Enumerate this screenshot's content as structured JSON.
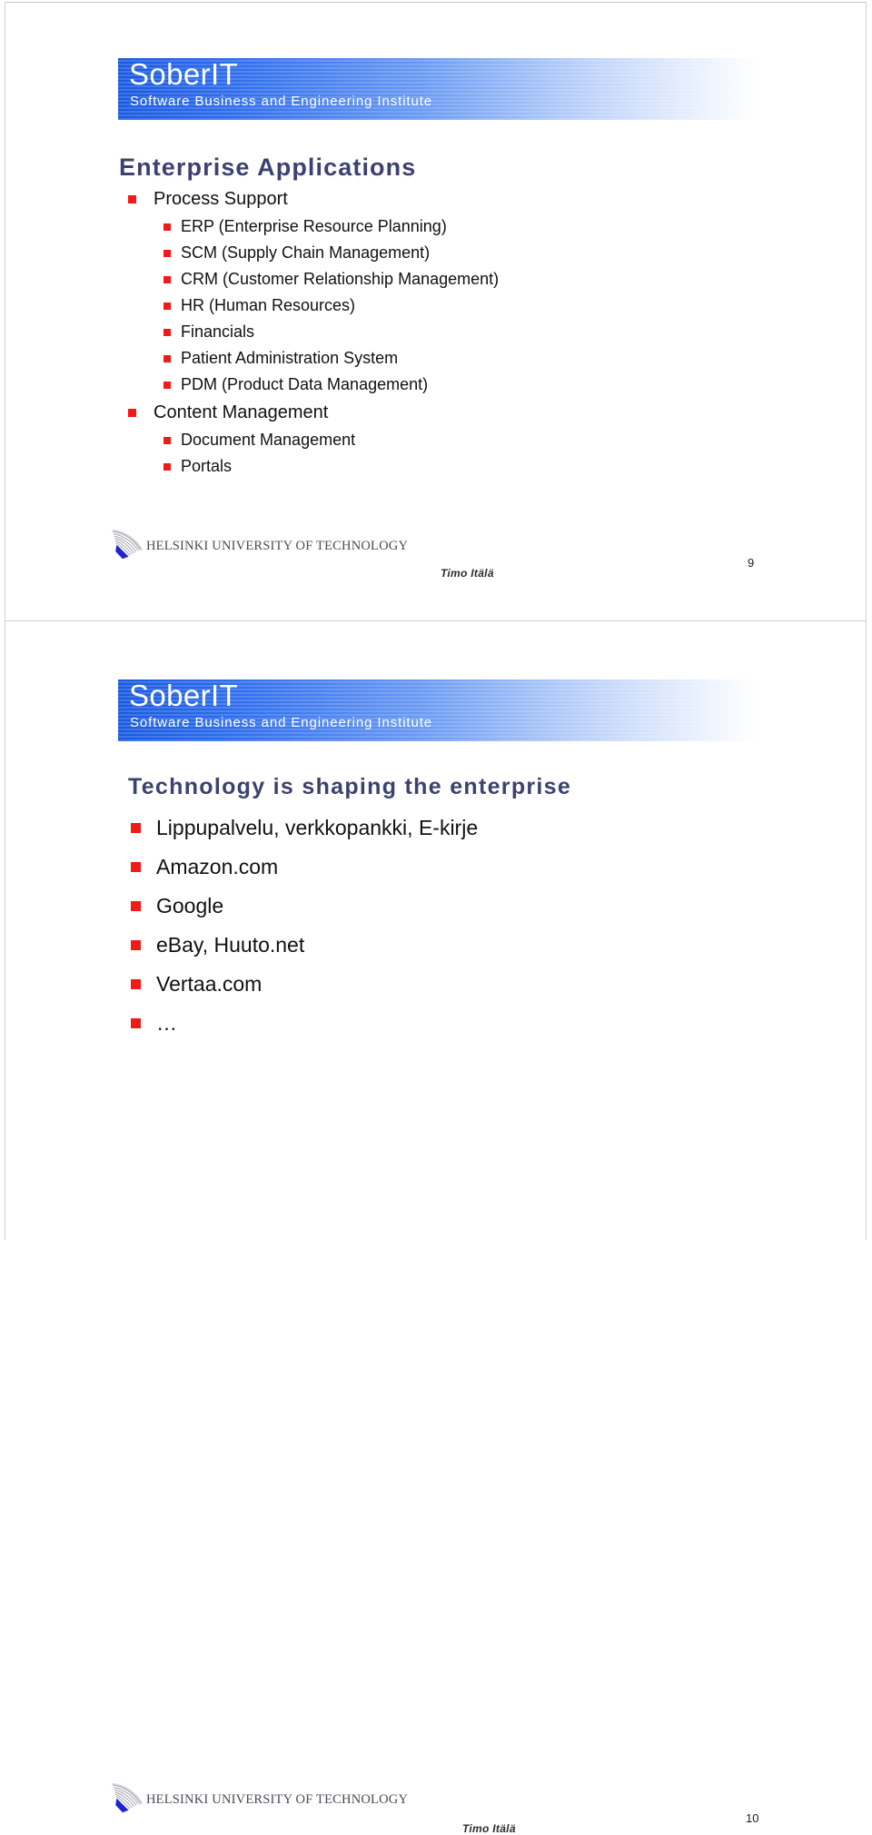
{
  "document": {
    "type": "lecture-slides-handout",
    "colors": {
      "bullet_red": "#ee1b19",
      "title_navy": "#3c4270",
      "banner_blue": "#1a5ae0",
      "banner_white": "#ffffff",
      "logo_blue": "#2222cc",
      "page_border": "#d2d2d2"
    }
  },
  "slides": [
    {
      "banner": {
        "title": "SoberIT",
        "subtitle": "Software Business and Engineering Institute"
      },
      "title": "Enterprise Applications",
      "bullets": [
        {
          "level": 1,
          "text": "Process Support"
        },
        {
          "level": 2,
          "text": "ERP (Enterprise Resource Planning)"
        },
        {
          "level": 2,
          "text": "SCM (Supply Chain Management)"
        },
        {
          "level": 2,
          "text": "CRM (Customer Relationship Management)"
        },
        {
          "level": 2,
          "text": "HR (Human Resources)"
        },
        {
          "level": 2,
          "text": "Financials"
        },
        {
          "level": 2,
          "text": "Patient Administration System"
        },
        {
          "level": 2,
          "text": "PDM (Product Data Management)"
        },
        {
          "level": 1,
          "text": "Content Management"
        },
        {
          "level": 2,
          "text": "Document Management"
        },
        {
          "level": 2,
          "text": "Portals"
        }
      ],
      "footer": {
        "organization": "HELSINKI UNIVERSITY OF TECHNOLOGY",
        "author": "Timo Itälä",
        "page_number": "9"
      }
    },
    {
      "banner": {
        "title": "SoberIT",
        "subtitle": "Software Business and Engineering Institute"
      },
      "title": "Technology is shaping the enterprise",
      "bullets": [
        {
          "level": 1,
          "text": "Lippupalvelu, verkkopankki, E-kirje"
        },
        {
          "level": 1,
          "text": "Amazon.com"
        },
        {
          "level": 1,
          "text": "Google"
        },
        {
          "level": 1,
          "text": "eBay, Huuto.net"
        },
        {
          "level": 1,
          "text": "Vertaa.com"
        },
        {
          "level": 1,
          "text": "…"
        }
      ],
      "footer": {
        "organization": "HELSINKI UNIVERSITY OF TECHNOLOGY",
        "author": "Timo Itälä",
        "page_number": "10"
      }
    }
  ]
}
